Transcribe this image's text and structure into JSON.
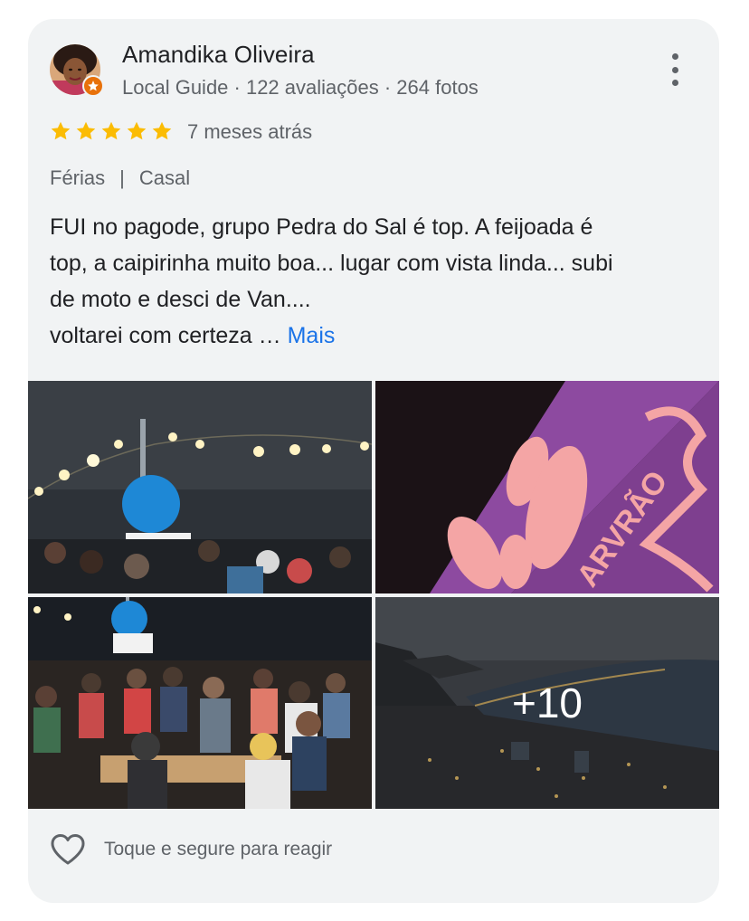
{
  "review": {
    "author": "Amandika Oliveira",
    "author_meta": "Local Guide · 122 avaliações · 264 fotos",
    "rating": 5,
    "rating_max": 5,
    "time_ago": "7 meses atrás",
    "tags": [
      "Férias",
      "Casal"
    ],
    "tag_separator": "|",
    "text_lines": [
      "FUI no pagode, grupo Pedra do Sal é top. A feijoada é",
      "top, a caipirinha muito boa... lugar com vista linda... subi",
      "de moto e desci de Van....",
      "voltarei com certeza …"
    ],
    "more_label": "Mais",
    "photos": [
      {
        "icon": "photo-night-crowd"
      },
      {
        "icon": "photo-purple-sign"
      },
      {
        "icon": "photo-band-crowd"
      },
      {
        "icon": "photo-city-view",
        "more_count": "+10"
      }
    ],
    "photo_sign_text": "ARVRÃO",
    "react_label": "Toque e segure para reagir",
    "colors": {
      "star": "#fbbc04",
      "link": "#1a73e8",
      "card_bg": "#f1f3f4",
      "badge": "#e8710a"
    }
  }
}
